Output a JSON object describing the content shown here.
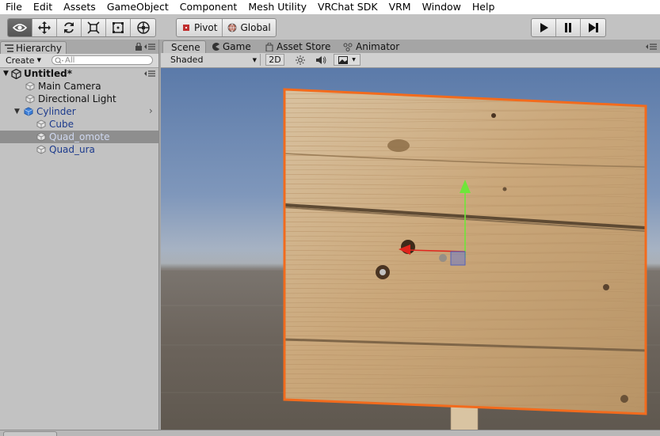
{
  "menu": [
    "File",
    "Edit",
    "Assets",
    "GameObject",
    "Component",
    "Mesh Utility",
    "VRChat SDK",
    "VRM",
    "Window",
    "Help"
  ],
  "toolbar": {
    "tools": [
      {
        "name": "view-tool",
        "icon": "eye-icon"
      },
      {
        "name": "move-tool",
        "icon": "move-arrows-icon"
      },
      {
        "name": "rotate-tool",
        "icon": "rotate-icon"
      },
      {
        "name": "scale-tool",
        "icon": "scale-icon"
      },
      {
        "name": "rect-tool",
        "icon": "rect-icon"
      },
      {
        "name": "transform-tool",
        "icon": "transform-icon"
      }
    ],
    "pivot_label": "Pivot",
    "global_label": "Global",
    "play_icons": [
      "play-icon",
      "pause-icon",
      "step-icon"
    ]
  },
  "hierarchy": {
    "tab_label": "Hierarchy",
    "create_label": "Create",
    "search_placeholder": "All",
    "scene_name": "Untitled*",
    "items": [
      {
        "label": "Main Camera"
      },
      {
        "label": "Directional Light"
      },
      {
        "label": "Cylinder"
      },
      {
        "label": "Cube"
      },
      {
        "label": "Quad_omote"
      },
      {
        "label": "Quad_ura"
      }
    ]
  },
  "scene": {
    "tabs": [
      {
        "label": "Scene"
      },
      {
        "label": "Game"
      },
      {
        "label": "Asset Store"
      },
      {
        "label": "Animator"
      }
    ],
    "shading_mode": "Shaded",
    "mode_2d": "2D"
  },
  "bottom_tabs": [],
  "colors": {
    "selection_outline": "#f26b1d",
    "gizmo_y": "#6ee63a",
    "gizmo_x": "#e0241c",
    "selected_row": "#8e8e8e",
    "prefab_text": "#1c3a8c"
  }
}
